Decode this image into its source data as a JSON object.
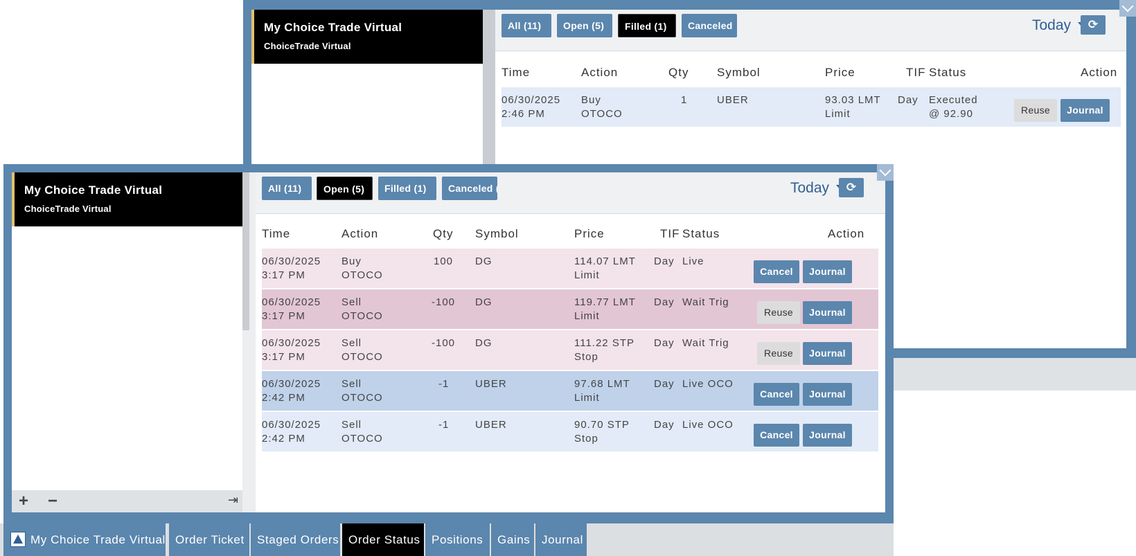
{
  "panel_top": {
    "account": {
      "name": "My Choice Trade Virtual",
      "sub": "ChoiceTrade Virtual"
    },
    "filters": [
      {
        "label": "All (11)",
        "active": false
      },
      {
        "label": "Open (5)",
        "active": false
      },
      {
        "label": "Filled (1)",
        "active": true
      },
      {
        "label": "Canceled",
        "active": false
      }
    ],
    "date_filter": "Today",
    "columns": {
      "time": "Time",
      "action": "Action",
      "qty": "Qty",
      "symbol": "Symbol",
      "price": "Price",
      "tif": "TIF",
      "status": "Status",
      "action2": "Action"
    },
    "rows": [
      {
        "date": "06/30/2025",
        "time": "2:46 PM",
        "side": "Buy",
        "type": "OTOCO",
        "qty": "1",
        "symbol": "UBER",
        "price": "93.03 LMT",
        "price_type": "Limit",
        "tif": "Day",
        "status": "Executed",
        "status2": "@ 92.90",
        "btn1": "Reuse",
        "btn2": "Journal",
        "bg": "#e2ebf7"
      }
    ]
  },
  "panel_main": {
    "account": {
      "name": "My Choice Trade Virtual",
      "sub": "ChoiceTrade Virtual"
    },
    "filters": [
      {
        "label": "All (11)",
        "active": false
      },
      {
        "label": "Open (5)",
        "active": true
      },
      {
        "label": "Filled (1)",
        "active": false
      },
      {
        "label": "Canceled (",
        "active": false
      }
    ],
    "date_filter": "Today",
    "columns": {
      "time": "Time",
      "action": "Action",
      "qty": "Qty",
      "symbol": "Symbol",
      "price": "Price",
      "tif": "TIF",
      "status": "Status",
      "action2": "Action"
    },
    "rows": [
      {
        "date": "06/30/2025",
        "time": "3:17 PM",
        "side": "Buy",
        "type": "OTOCO",
        "qty": "100",
        "symbol": "DG",
        "price": "114.07 LMT",
        "price_type": "Limit",
        "tif": "Day",
        "status": "Live",
        "btn1": "Cancel",
        "btn2": "Journal",
        "bg": "#f3e3ea"
      },
      {
        "date": "06/30/2025",
        "time": "3:17 PM",
        "side": "Sell",
        "type": "OTOCO",
        "qty": "-100",
        "symbol": "DG",
        "price": "119.77 LMT",
        "price_type": "Limit",
        "tif": "Day",
        "status": "Wait Trig",
        "btn1": "Reuse",
        "btn2": "Journal",
        "bg": "#e3c6d3"
      },
      {
        "date": "06/30/2025",
        "time": "3:17 PM",
        "side": "Sell",
        "type": "OTOCO",
        "qty": "-100",
        "symbol": "DG",
        "price": "111.22 STP",
        "price_type": "Stop",
        "tif": "Day",
        "status": "Wait Trig",
        "btn1": "Reuse",
        "btn2": "Journal",
        "bg": "#f3e3ea"
      },
      {
        "date": "06/30/2025",
        "time": "2:42 PM",
        "side": "Sell",
        "type": "OTOCO",
        "qty": "-1",
        "symbol": "UBER",
        "price": "97.68 LMT",
        "price_type": "Limit",
        "tif": "Day",
        "status": "Live OCO",
        "btn1": "Cancel",
        "btn2": "Journal",
        "bg": "#bfd2ea"
      },
      {
        "date": "06/30/2025",
        "time": "2:42 PM",
        "side": "Sell",
        "type": "OTOCO",
        "qty": "-1",
        "symbol": "UBER",
        "price": "90.70 STP",
        "price_type": "Stop",
        "tif": "Day",
        "status": "Live OCO",
        "btn1": "Cancel",
        "btn2": "Journal",
        "bg": "#e2ebf7"
      }
    ],
    "bottom_icons": [
      "plus-icon",
      "minus-icon",
      "logout-icon"
    ]
  },
  "taskbar": {
    "tabs": [
      {
        "label": "My Choice Trade Virtual",
        "active": false,
        "icon": "app-logo-icon"
      },
      {
        "label": "Order Ticket",
        "active": false
      },
      {
        "label": "Staged Orders",
        "active": false
      },
      {
        "label": "Order Status",
        "active": true
      },
      {
        "label": "Positions",
        "active": false
      },
      {
        "label": "Gains",
        "active": false
      },
      {
        "label": "Journal",
        "active": false
      }
    ]
  },
  "colors": {
    "frame": "#5b86ad",
    "active": "#000000",
    "accent_bar": "#e6c071",
    "link_blue": "#2f5f93"
  }
}
